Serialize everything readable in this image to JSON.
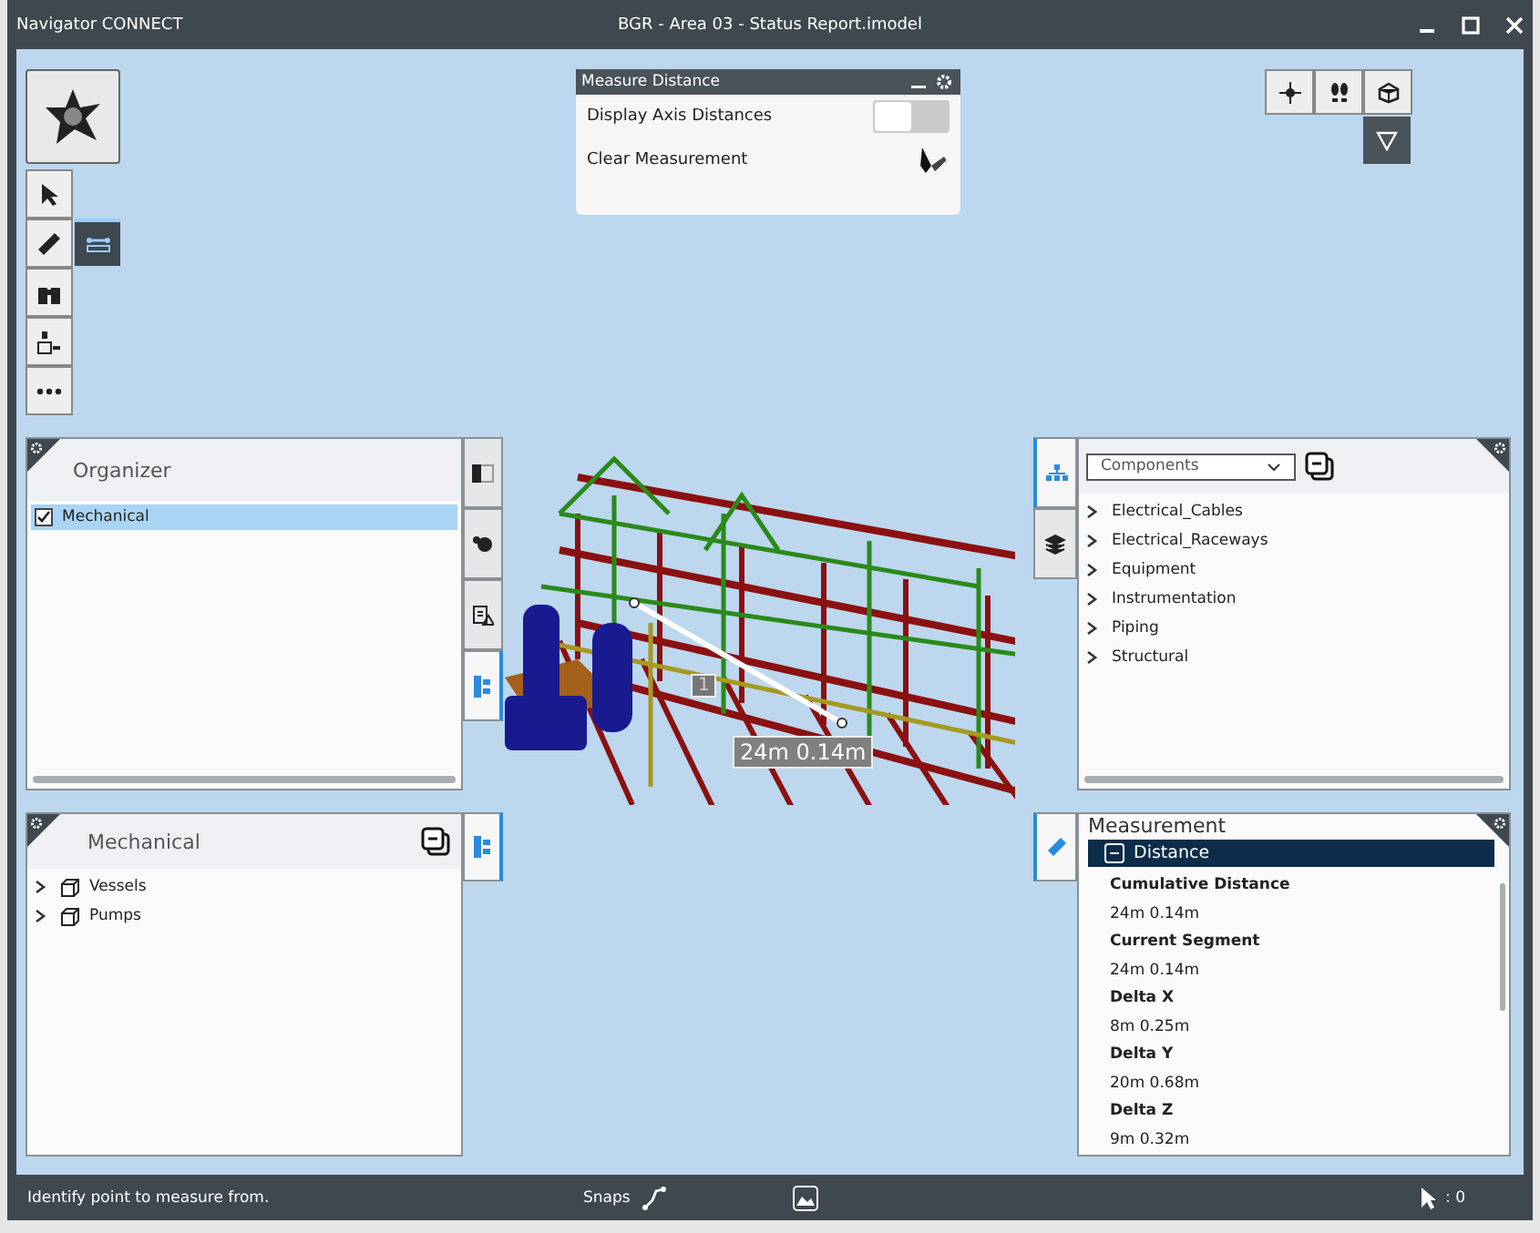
{
  "window": {
    "app_name": "Navigator CONNECT",
    "title": "BGR - Area 03 - Status Report.imodel"
  },
  "measure_panel": {
    "title": "Measure Distance",
    "rows": [
      {
        "kind": "toggle",
        "label": "Display Axis Distances",
        "on": false
      },
      {
        "kind": "action",
        "label": "Clear Measurement"
      }
    ]
  },
  "organizer": {
    "title": "Organizer",
    "items": [
      {
        "label": "Mechanical",
        "checked": true,
        "selected": true
      }
    ],
    "tabs": [
      {
        "selected": false
      },
      {
        "selected": false
      },
      {
        "selected": false
      },
      {
        "selected": true
      }
    ]
  },
  "components": {
    "dropdown": "Components",
    "tabs": [
      {
        "selected": true
      },
      {
        "selected": false
      }
    ],
    "items": [
      {
        "label": "Electrical_Cables",
        "expanded": false
      },
      {
        "label": "Electrical_Raceways",
        "expanded": false
      },
      {
        "label": "Equipment",
        "expanded": false
      },
      {
        "label": "Instrumentation",
        "expanded": false
      },
      {
        "label": "Piping",
        "expanded": false
      },
      {
        "label": "Structural",
        "expanded": false
      }
    ]
  },
  "mechanical": {
    "title": "Mechanical",
    "items": [
      {
        "label": "Vessels",
        "expanded": false
      },
      {
        "label": "Pumps",
        "expanded": false
      }
    ]
  },
  "measurement": {
    "title": "Measurement",
    "section": {
      "label": "Distance",
      "expanded": true
    },
    "fields": [
      {
        "label": "Cumulative Distance",
        "value": "24m 0.14m"
      },
      {
        "label": "Current Segment",
        "value": "24m 0.14m"
      },
      {
        "label": "Delta X",
        "value": "8m 0.25m"
      },
      {
        "label": "Delta Y",
        "value": "20m 0.68m"
      },
      {
        "label": "Delta Z",
        "value": "9m 0.32m"
      }
    ]
  },
  "viewport": {
    "measure_label": "24m 0.14m",
    "point_label": "1"
  },
  "status_bar": {
    "prompt": "Identify point to measure from.",
    "snaps": "Snaps",
    "selection_count": ": 0"
  }
}
